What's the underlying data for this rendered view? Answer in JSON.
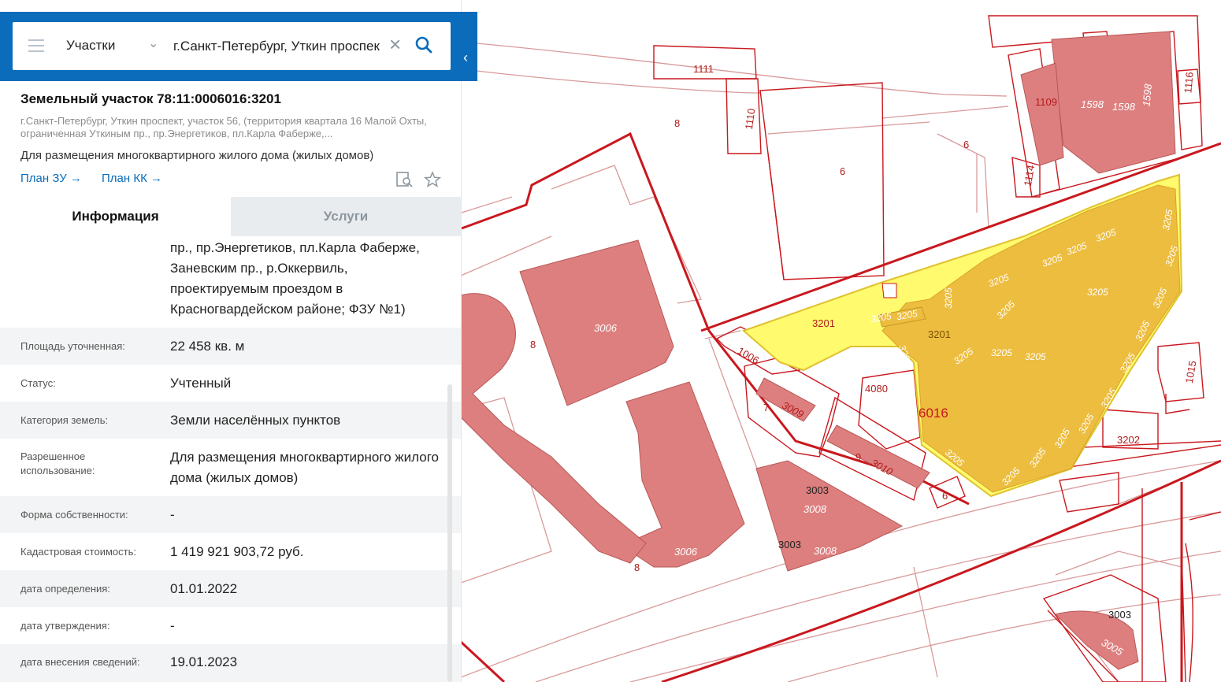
{
  "search": {
    "layer_label": "Участки",
    "query": "г.Санкт-Петербург, Уткин проспект"
  },
  "parcel": {
    "title": "Земельный участок 78:11:0006016:3201",
    "address": "г.Санкт-Петербург, Уткин проспект, участок 56, (территория квартала 16 Малой Охты, ограниченная Уткиным пр., пр.Энергетиков, пл.Карла Фаберже,...",
    "usage": "Для размещения многоквартирного жилого дома (жилых домов)",
    "plan_zu": "План ЗУ →",
    "plan_kk": "План КК →"
  },
  "tabs": {
    "info": "Информация",
    "services": "Услуги"
  },
  "info": {
    "address_cont": "пр., пр.Энергетиков, пл.Карла Фаберже, Заневским пр., р.Оккервиль, проектируемым проездом в Красногвардейском районе; ФЗУ №1)",
    "rows": [
      {
        "label": "Площадь уточненная:",
        "value": "22 458 кв. м"
      },
      {
        "label": "Статус:",
        "value": "Учтенный"
      },
      {
        "label": "Категория земель:",
        "value": "Земли населённых пунктов"
      },
      {
        "label": "Разрешенное использование:",
        "value": "Для размещения многоквартирного жилого дома (жилых домов)"
      },
      {
        "label": "Форма собственности:",
        "value": "-"
      },
      {
        "label": "Кадастровая стоимость:",
        "value": "1 419 921 903,72 руб."
      },
      {
        "label": "дата определения:",
        "value": "01.01.2022"
      },
      {
        "label": "дата утверждения:",
        "value": "-"
      },
      {
        "label": "дата внесения сведений:",
        "value": "19.01.2023"
      }
    ]
  },
  "map": {
    "labels": {
      "l1111": "1111",
      "l1110": "1110",
      "l8a": "8",
      "l6a": "6",
      "l6b": "6",
      "l1109": "1109",
      "l1598a": "1598",
      "l1598b": "1598",
      "l1598c": "1598",
      "l1116": "1116",
      "l1114": "1114",
      "l3006a": "3006",
      "l3006b": "3006",
      "l8b": "8",
      "l8c": "8",
      "l1006": "1006",
      "l7": "7",
      "l3009": "3009",
      "l4080": "4080",
      "l9": "9",
      "l3010": "3010",
      "l6c": "6",
      "l3003a": "3003",
      "l3008a": "3008",
      "l3003b": "3003",
      "l3008b": "3008",
      "l3201a": "3201",
      "l3201b": "3201",
      "l6016": "6016",
      "l3202": "3202",
      "l1015": "1015",
      "l3003c": "3003",
      "l3005": "3005",
      "s1": "3205",
      "s2": "3205",
      "s3": "3205",
      "s4": "3205",
      "s5": "3205",
      "s6": "3205",
      "s7": "3205",
      "s8": "3205",
      "s9": "3205",
      "s10": "3205",
      "s11": "3205",
      "s12": "3205",
      "s13": "3205",
      "s14": "3205",
      "s15": "3205",
      "s16": "3205",
      "s17": "3205",
      "s18": "3205",
      "s19": "3205",
      "s20": "3205",
      "s21": "3205",
      "s22": "3205",
      "s23": "3205",
      "s24": "3205"
    }
  },
  "colors": {
    "header_blue": "#0a6cba",
    "parcel_red": "#c9181e",
    "building_fill": "#de7f7f",
    "highlight_yellow": "#fffa6e",
    "building_highlight": "#edbd40"
  }
}
